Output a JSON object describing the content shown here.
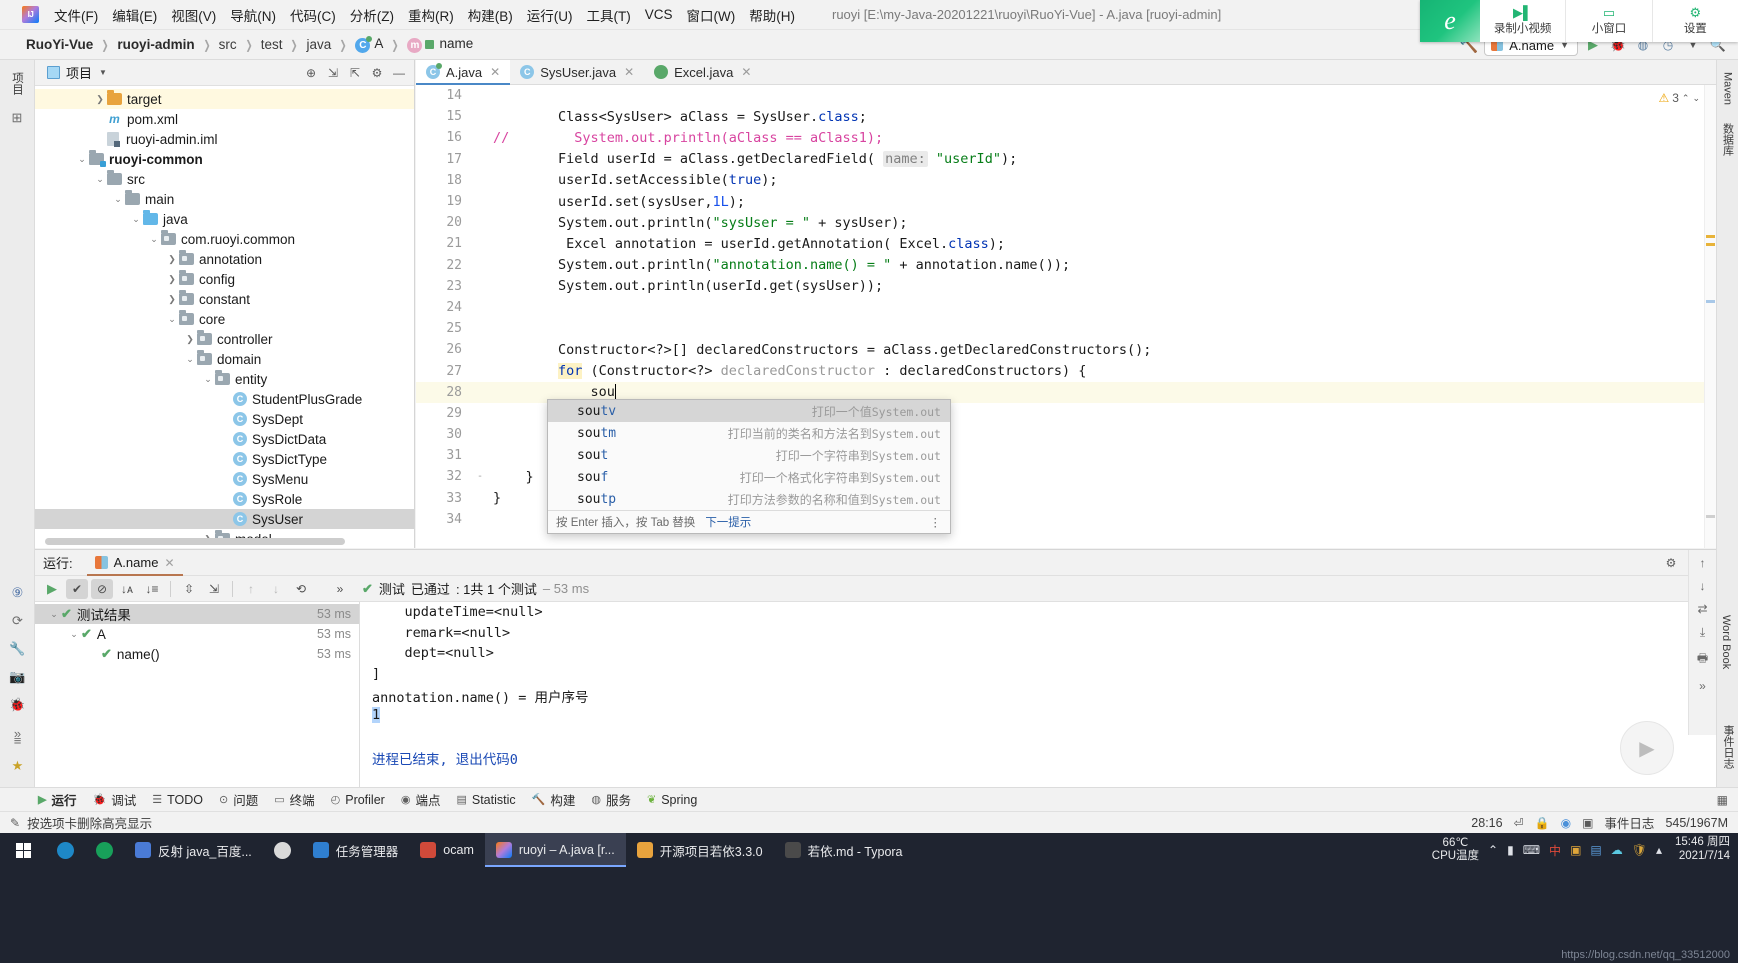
{
  "window": {
    "title": "ruoyi [E:\\my-Java-20201221\\ruoyi\\RuoYi-Vue] - A.java [ruoyi-admin]"
  },
  "menubar": {
    "items": [
      "文件(F)",
      "编辑(E)",
      "视图(V)",
      "导航(N)",
      "代码(C)",
      "分析(Z)",
      "重构(R)",
      "构建(B)",
      "运行(U)",
      "工具(T)",
      "VCS",
      "窗口(W)",
      "帮助(H)"
    ]
  },
  "recorder": {
    "brand_glyph": "e",
    "buttons": [
      {
        "label": "录制小视频",
        "icon": "video-record-icon",
        "glyph": "▶▌"
      },
      {
        "label": "小窗口",
        "icon": "small-window-icon",
        "glyph": "▭"
      },
      {
        "label": "设置",
        "icon": "gear-icon",
        "glyph": "⚙"
      }
    ]
  },
  "breadcrumb": {
    "items": [
      {
        "label": "RuoYi-Vue",
        "bold": true
      },
      {
        "label": "ruoyi-admin",
        "bold": true
      },
      {
        "label": "src",
        "bold": false
      },
      {
        "label": "test",
        "bold": false
      },
      {
        "label": "java",
        "bold": false
      },
      {
        "label": "A",
        "bold": false,
        "icon": "class-icon"
      },
      {
        "label": "name",
        "bold": false,
        "icon": "method-icon"
      }
    ]
  },
  "toolbar_right": {
    "hammer_icon": "build-hammer-icon",
    "run_config": "A.name",
    "run_icon": "run-play-icon",
    "debug_icon": "debug-bug-icon",
    "coverage_icon": "run-coverage-icon",
    "profile_icon": "run-profile-icon",
    "search_icon": "search-icon",
    "settings_icon": "gear-icon"
  },
  "left_strip": {
    "tabs": [
      "项目"
    ],
    "icons": [
      "favorites-star-icon",
      "commit-icon"
    ]
  },
  "right_strip": {
    "tabs": [
      "Maven",
      "数据库",
      "Word Book",
      "事件日志"
    ]
  },
  "project_panel": {
    "title": "项目",
    "head_icons": [
      "locate-target-icon",
      "expand-all-icon",
      "collapse-all-icon",
      "gear-icon",
      "hide-icon"
    ],
    "tree": [
      {
        "depth": 3,
        "label": "target",
        "icon": "folder-orange",
        "chevron": ">",
        "state": "highlight"
      },
      {
        "depth": 3,
        "label": "pom.xml",
        "icon": "maven-m-icon",
        "chevron": "",
        "state": ""
      },
      {
        "depth": 3,
        "label": "ruoyi-admin.iml",
        "icon": "iml-icon",
        "chevron": "",
        "state": ""
      },
      {
        "depth": 2,
        "label": "ruoyi-common",
        "icon": "folder-module",
        "chevron": "v",
        "state": "",
        "bold": true
      },
      {
        "depth": 3,
        "label": "src",
        "icon": "folder-gray",
        "chevron": "v",
        "state": ""
      },
      {
        "depth": 4,
        "label": "main",
        "icon": "folder-gray",
        "chevron": "v",
        "state": ""
      },
      {
        "depth": 5,
        "label": "java",
        "icon": "folder-blue",
        "chevron": "v",
        "state": ""
      },
      {
        "depth": 6,
        "label": "com.ruoyi.common",
        "icon": "folder-package",
        "chevron": "v",
        "state": ""
      },
      {
        "depth": 7,
        "label": "annotation",
        "icon": "folder-package",
        "chevron": ">",
        "state": ""
      },
      {
        "depth": 7,
        "label": "config",
        "icon": "folder-package",
        "chevron": ">",
        "state": ""
      },
      {
        "depth": 7,
        "label": "constant",
        "icon": "folder-package",
        "chevron": ">",
        "state": ""
      },
      {
        "depth": 7,
        "label": "core",
        "icon": "folder-package",
        "chevron": "v",
        "state": ""
      },
      {
        "depth": 8,
        "label": "controller",
        "icon": "folder-package",
        "chevron": ">",
        "state": ""
      },
      {
        "depth": 8,
        "label": "domain",
        "icon": "folder-package",
        "chevron": "v",
        "state": ""
      },
      {
        "depth": 9,
        "label": "entity",
        "icon": "folder-package",
        "chevron": "v",
        "state": ""
      },
      {
        "depth": 10,
        "label": "StudentPlusGrade",
        "icon": "class-icon",
        "chevron": "",
        "state": ""
      },
      {
        "depth": 10,
        "label": "SysDept",
        "icon": "class-icon",
        "chevron": "",
        "state": ""
      },
      {
        "depth": 10,
        "label": "SysDictData",
        "icon": "class-icon",
        "chevron": "",
        "state": ""
      },
      {
        "depth": 10,
        "label": "SysDictType",
        "icon": "class-icon",
        "chevron": "",
        "state": ""
      },
      {
        "depth": 10,
        "label": "SysMenu",
        "icon": "class-icon",
        "chevron": "",
        "state": ""
      },
      {
        "depth": 10,
        "label": "SysRole",
        "icon": "class-icon",
        "chevron": "",
        "state": ""
      },
      {
        "depth": 10,
        "label": "SysUser",
        "icon": "class-icon",
        "chevron": "",
        "state": "selected"
      },
      {
        "depth": 9,
        "label": "model",
        "icon": "folder-package",
        "chevron": ">",
        "state": ""
      }
    ]
  },
  "editor": {
    "tabs": [
      {
        "label": "A.java",
        "icon": "class-icon",
        "active": true,
        "closable": true
      },
      {
        "label": "SysUser.java",
        "icon": "class-icon",
        "active": false,
        "closable": true
      },
      {
        "label": "Excel.java",
        "icon": "annotation-icon",
        "active": false,
        "closable": true
      }
    ],
    "inspection": {
      "warning_count": "3",
      "up_icon": "chevron-up-icon",
      "down_icon": "chevron-down-icon"
    },
    "lines": [
      {
        "no": "14",
        "text": "",
        "fold": ""
      },
      {
        "no": "15",
        "text": "        Class<SysUser> aClass = SysUser.class;",
        "fold": ""
      },
      {
        "no": "16",
        "text": "//        System.out.println(aClass == aClass1);",
        "fold": ""
      },
      {
        "no": "17",
        "text": "        Field userId = aClass.getDeclaredField( name: \"userId\");",
        "fold": ""
      },
      {
        "no": "18",
        "text": "        userId.setAccessible(true);",
        "fold": ""
      },
      {
        "no": "19",
        "text": "        userId.set(sysUser,1L);",
        "fold": ""
      },
      {
        "no": "20",
        "text": "        System.out.println(\"sysUser = \" + sysUser);",
        "fold": ""
      },
      {
        "no": "21",
        "text": "        Excel annotation = userId.getAnnotation(Excel.class);",
        "fold": ""
      },
      {
        "no": "22",
        "text": "        System.out.println(\"annotation.name() = \" + annotation.name());",
        "fold": ""
      },
      {
        "no": "23",
        "text": "        System.out.println(userId.get(sysUser));",
        "fold": ""
      },
      {
        "no": "24",
        "text": "",
        "fold": ""
      },
      {
        "no": "25",
        "text": "",
        "fold": ""
      },
      {
        "no": "26",
        "text": "        Constructor<?>[] declaredConstructors = aClass.getDeclaredConstructors();",
        "fold": ""
      },
      {
        "no": "27",
        "text": "        for (Constructor<?> declaredConstructor : declaredConstructors) {",
        "fold": ""
      },
      {
        "no": "28",
        "text": "            sou",
        "fold": "",
        "current": true
      },
      {
        "no": "29",
        "text": "        }",
        "fold": ""
      },
      {
        "no": "30",
        "text": "",
        "fold": ""
      },
      {
        "no": "31",
        "text": "",
        "fold": ""
      },
      {
        "no": "32",
        "text": "    }",
        "fold": "-"
      },
      {
        "no": "33",
        "text": "}",
        "fold": ""
      },
      {
        "no": "34",
        "text": "",
        "fold": ""
      }
    ]
  },
  "autocomplete": {
    "items": [
      {
        "prefix": "sou",
        "suffix": "tv",
        "desc": "打印一个值",
        "desc_mono": "System.out",
        "selected": true
      },
      {
        "prefix": "sou",
        "suffix": "tm",
        "desc": "打印当前的类名和方法名到",
        "desc_mono": "System.out",
        "selected": false
      },
      {
        "prefix": "sou",
        "suffix": "t",
        "desc": "打印一个字符串到",
        "desc_mono": "System.out",
        "selected": false
      },
      {
        "prefix": "sou",
        "suffix": "f",
        "desc": "打印一个格式化字符串到",
        "desc_mono": "System.out",
        "selected": false
      },
      {
        "prefix": "sou",
        "suffix": "tp",
        "desc": "打印方法参数的名称和值到",
        "desc_mono": "System.out",
        "selected": false
      }
    ],
    "footer": {
      "hint": "按 Enter 插入，按 Tab 替换",
      "link": "下一提示",
      "menu_icon": "more-options-icon"
    }
  },
  "run_panel": {
    "label": "运行:",
    "tab": "A.name",
    "tab_close_icon": "close-icon",
    "settings_icon": "gear-icon",
    "minimize_icon": "minimize-icon",
    "toolbar_icons": [
      "rerun-play-icon",
      "show-passed-check-icon",
      "show-ignored-icon",
      "sort-alpha-icon",
      "sort-duration-icon",
      "expand-all-icon",
      "collapse-all-icon",
      "prev-failed-icon",
      "next-failed-icon",
      "history-icon",
      "more-icon"
    ],
    "status": {
      "check_icon": "check-icon",
      "prefix": "测试",
      "passed": "已通过",
      "detail": ": 1共 1 个测试",
      "duration": "– 53 ms"
    },
    "tests": [
      {
        "depth": 0,
        "label": "测试结果",
        "ms": "53 ms",
        "chevron": "v",
        "selected": true
      },
      {
        "depth": 1,
        "label": "A",
        "ms": "53 ms",
        "chevron": "v",
        "selected": false
      },
      {
        "depth": 2,
        "label": "name()",
        "ms": "53 ms",
        "chevron": "",
        "selected": false
      }
    ],
    "console": [
      {
        "text": "    updateTime=<null>",
        "style": "normal"
      },
      {
        "text": "    remark=<null>",
        "style": "normal"
      },
      {
        "text": "    dept=<null>",
        "style": "normal"
      },
      {
        "text": "]",
        "style": "normal"
      },
      {
        "text": "annotation.name() = 用户序号",
        "style": "normal"
      },
      {
        "text": "1",
        "style": "selected"
      },
      {
        "text": "",
        "style": "normal"
      },
      {
        "text": "进程已结束, 退出代码0",
        "style": "link"
      }
    ],
    "console_right_icons": [
      "scroll-up-icon",
      "scroll-down-icon",
      "soft-wrap-icon",
      "export-icon",
      "print-icon",
      "clear-icon",
      "more-icon"
    ],
    "left_icons": [
      "9-badge-icon",
      "rerun-icon",
      "stop-icon",
      "wrench-icon",
      "camera-icon",
      "bug-icon",
      "more-icon"
    ]
  },
  "tool_window_bar": {
    "items": [
      {
        "label": "运行",
        "icon": "run-play-icon",
        "active": true
      },
      {
        "label": "调试",
        "icon": "debug-bug-icon",
        "active": false
      },
      {
        "label": "TODO",
        "icon": "todo-list-icon",
        "active": false
      },
      {
        "label": "问题",
        "icon": "problems-icon",
        "active": false
      },
      {
        "label": "终端",
        "icon": "terminal-icon",
        "active": false
      },
      {
        "label": "Profiler",
        "icon": "profiler-icon",
        "active": false
      },
      {
        "label": "端点",
        "icon": "endpoints-icon",
        "active": false
      },
      {
        "label": "Statistic",
        "icon": "statistic-icon",
        "active": false
      },
      {
        "label": "构建",
        "icon": "build-hammer-icon",
        "active": false
      },
      {
        "label": "服务",
        "icon": "services-icon",
        "active": false
      },
      {
        "label": "Spring",
        "icon": "spring-leaf-icon",
        "active": false
      }
    ],
    "right_icons": [
      "layout-icon",
      "hide-icon"
    ]
  },
  "statusbar": {
    "message": "按选项卡删除高亮显示",
    "caret": "28:16",
    "lf_icon": "line-separator-icon",
    "encoding_icon": "encoding-icon",
    "chrome_icon": "chrome-icon",
    "event_log": "事件日志",
    "event_log_icon": "event-log-icon",
    "memory": "545/1967M"
  },
  "taskbar": {
    "start_icon": "windows-start-icon",
    "items": [
      {
        "label": "",
        "icon": "edge-browser-icon",
        "color": "#1e88c7",
        "shape": "circle",
        "active": false
      },
      {
        "label": "",
        "icon": "internet-explorer-icon",
        "color": "#18a05a",
        "shape": "circle",
        "active": false
      },
      {
        "label": "反射 java_百度...",
        "icon": "baidu-icon",
        "color": "#4a7bd6",
        "shape": "square",
        "active": false
      },
      {
        "label": "",
        "icon": "chrome-icon",
        "color": "#d9d9d9",
        "shape": "circle",
        "active": false
      },
      {
        "label": "任务管理器",
        "icon": "task-manager-icon",
        "color": "#2f7fd0",
        "shape": "square",
        "active": false
      },
      {
        "label": "ocam",
        "icon": "ocam-icon",
        "color": "#d04a3a",
        "shape": "square",
        "active": false
      },
      {
        "label": "ruoyi – A.java [r...",
        "icon": "intellij-idea-icon",
        "color": "#b07bda",
        "shape": "square",
        "active": true
      },
      {
        "label": "开源项目若依3.3.0",
        "icon": "folder-icon",
        "color": "#e8a33d",
        "shape": "square",
        "active": false
      },
      {
        "label": "若依.md - Typora",
        "icon": "typora-icon",
        "color": "#4a4a4a",
        "shape": "square",
        "active": false
      }
    ],
    "temperature": {
      "value": "66℃",
      "label": "CPU温度"
    },
    "tray_icons": [
      "chevron-up-icon",
      "battery-icon",
      "keyboard-icon",
      "input-method-icon",
      "volume-icon",
      "network-icon",
      "cloud-icon",
      "shield-icon",
      "more-icon"
    ],
    "clock": {
      "time": "15:46 周四",
      "date": "2021/7/14"
    },
    "watermark": "https://blog.csdn.net/qq_33512000"
  }
}
